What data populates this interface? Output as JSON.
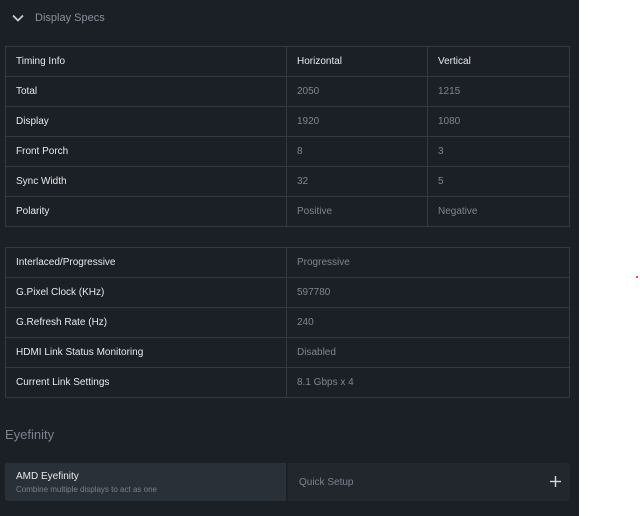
{
  "section": {
    "title": "Display Specs"
  },
  "timing": {
    "headers": [
      "Timing Info",
      "Horizontal",
      "Vertical"
    ],
    "rows": [
      {
        "label": "Total",
        "h": "2050",
        "v": "1215"
      },
      {
        "label": "Display",
        "h": "1920",
        "v": "1080"
      },
      {
        "label": "Front Porch",
        "h": "8",
        "v": "3"
      },
      {
        "label": "Sync Width",
        "h": "32",
        "v": "5"
      },
      {
        "label": "Polarity",
        "h": "Positive",
        "v": "Negative"
      }
    ]
  },
  "link": {
    "rows": [
      {
        "label": "Interlaced/Progressive",
        "value": "Progressive"
      },
      {
        "label": "G.Pixel Clock (KHz)",
        "value": "597780"
      },
      {
        "label": "G.Refresh Rate (Hz)",
        "value": "240"
      },
      {
        "label": "HDMI Link Status Monitoring",
        "value": "Disabled"
      },
      {
        "label": "Current Link Settings",
        "value": "8.1 Gbps x 4"
      }
    ]
  },
  "eyefinity": {
    "section_title": "Eyefinity",
    "name": "AMD Eyefinity",
    "description": "Combine multiple displays to act as one",
    "action_label": "Quick Setup"
  },
  "icons": {
    "collapse": "chevron-down-icon",
    "add": "plus-icon"
  },
  "colors": {
    "panel_bg": "#1b2027",
    "accent_dot": "#d62020"
  }
}
